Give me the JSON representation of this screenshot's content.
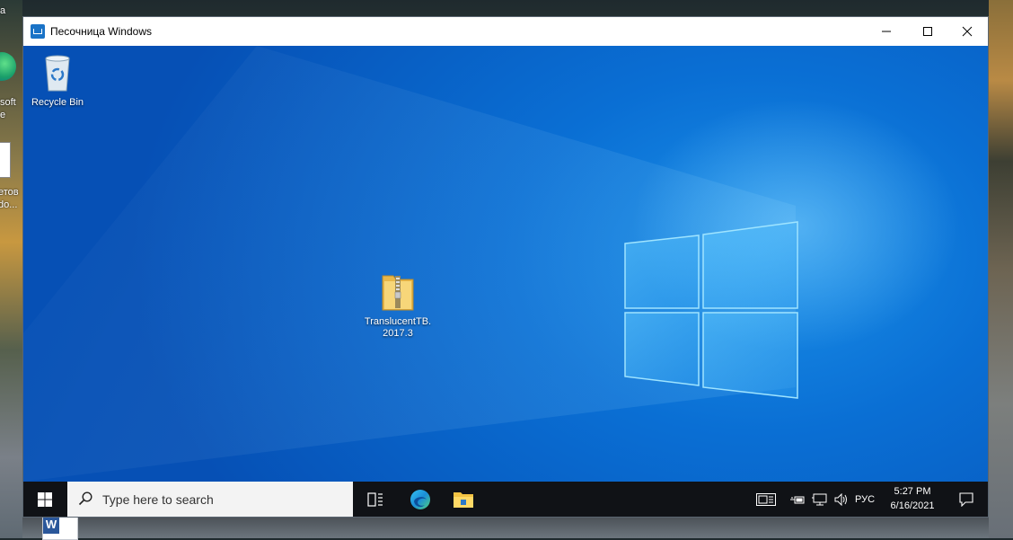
{
  "window": {
    "title": "Песочница Windows"
  },
  "host": {
    "labels": [
      "а",
      "soft",
      "e",
      "етов",
      "do..."
    ]
  },
  "desktop": {
    "icons": [
      {
        "label": "Recycle Bin",
        "icon": "recycle-bin-icon"
      },
      {
        "label": "TranslucentTB.2017.3",
        "icon": "zip-folder-icon"
      }
    ]
  },
  "taskbar": {
    "search_placeholder": "Type here to search",
    "language": "РУС",
    "time": "5:27 PM",
    "date": "6/16/2021"
  },
  "colors": {
    "taskbar_bg": "#101216",
    "desktop_blue": "#0a6fd4",
    "accent": "#1a73c7"
  }
}
